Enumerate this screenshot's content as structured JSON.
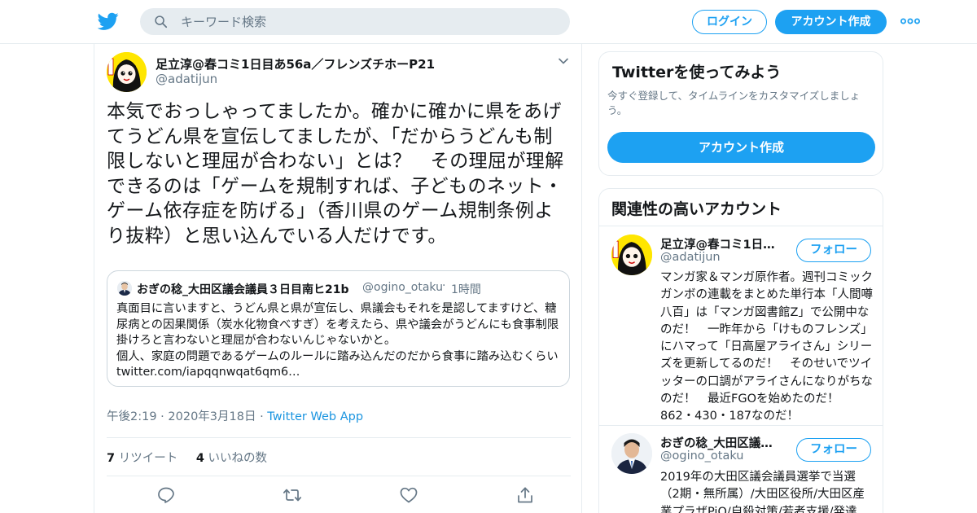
{
  "header": {
    "search_placeholder": "キーワード検索",
    "login_label": "ログイン",
    "signup_label": "アカウント作成"
  },
  "tweet": {
    "author_name": "足立淳@春コミ1日目あ56a／フレンズチホーP21",
    "author_handle": "@adatijun",
    "text": "本気でおっしゃってましたか。確かに確かに県をあげてうどん県を宣伝してましたが、「だからうどんも制限しないと理屈が合わない」とは？　その理屈が理解できるのは「ゲームを規制すれば、子どものネット・ゲーム依存症を防げる」（香川県のゲーム規制条例より抜粋）と思い込んでいる人だけです。",
    "quote": {
      "name": "おぎの稔_大田区議会議員３日目南ヒ21b",
      "handle": "@ogino_otaku",
      "separator": "·",
      "time": "1時間",
      "text": "真面目に言いますと、うどん県と県が宣伝し、県議会もそれを是認してますけど、糖尿病との因果関係（炭水化物食べすぎ）を考えたら、県や議会がうどんにも食事制限掛けろと言わないと理屈が合わないんじゃないかと。\n個人、家庭の問題であるゲームのルールに踏み込んだのだから食事に踏み込むくらい twitter.com/iapqqnwqat6qm6…"
    },
    "timestamp": "午後2:19 · 2020年3月18日 · ",
    "source_app": "Twitter Web App",
    "retweet_count": "7",
    "retweet_label": "リツイート",
    "like_count": "4",
    "like_label": "いいねの数"
  },
  "sidebar": {
    "try_card": {
      "title": "Twitterを使ってみよう",
      "subtitle": "今すぐ登録して、タイムラインをカスタマイズしましょう。",
      "button_label": "アカウント作成"
    },
    "related": {
      "title": "関連性の高いアカウント",
      "follow_label": "フォロー",
      "accounts": [
        {
          "name": "足立淳@春コミ1日…",
          "handle": "@adatijun",
          "bio": "マンガ家＆マンガ原作者。週刊コミックガンボの連載をまとめた単行本「人間噂八百」は「マンガ図書館Z」で公開中なのだ！　一昨年から「けものフレンズ」にハマって「日高屋アライさん」シリーズを更新してるのだ！　そのせいでツイッターの口調がアライさんになりがちなのだ！　最近FGOを始めたのだ！　862・430・187なのだ！"
        },
        {
          "name": "おぎの稔_大田区議…",
          "handle": "@ogino_otaku",
          "bio": "2019年の大田区議会議員選挙で当選（2期・無所属）/大田区役所/大田区産業プラザPiO/自殺対策/若者支援/発達"
        }
      ]
    }
  },
  "colors": {
    "accent": "#1da1f2",
    "link": "#1b95e0",
    "secondary_text": "#657786",
    "border": "#e6ecf0"
  },
  "icons": [
    "twitter-bird-icon",
    "search-icon",
    "more-dots-icon",
    "chevron-down-icon",
    "reply-icon",
    "retweet-icon",
    "like-icon",
    "share-icon"
  ]
}
